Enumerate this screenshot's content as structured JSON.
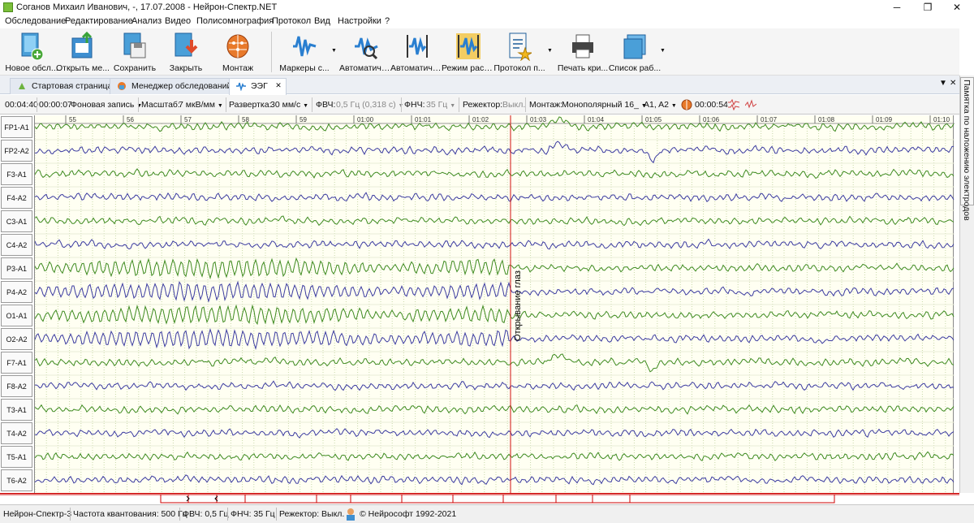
{
  "window": {
    "title": "Соганов Михаил Иванович, -, 17.07.2008 - Нейрон-Спектр.NET",
    "minimize": "─",
    "maximize": "❐",
    "close": "✕"
  },
  "menu": [
    "Обследование",
    "Редактирование",
    "Анализ",
    "Видео",
    "Полисомнография",
    "Протокол",
    "Вид",
    "Настройки",
    "?"
  ],
  "toolbar": {
    "new_exam": "Новое обсл...",
    "open": "Открыть ме...",
    "save": "Сохранить",
    "close": "Закрыть",
    "montage": "Монтаж",
    "markers": "Маркеры с...",
    "auto1": "Автоматиче...",
    "auto2": "Автоматиче...",
    "review_mode": "Режим расс...",
    "protocol": "Протокол п...",
    "print": "Печать кри...",
    "work_list": "Список раб...",
    "dropdown_arrow": "▼"
  },
  "tabs": {
    "start": "Стартовая страница",
    "manager": "Менеджер обследований",
    "eeg": "ЭЭГ",
    "close_mark": "✕",
    "pin_menu": "▼",
    "close_all": "✕"
  },
  "settings": {
    "time_pos": "00:04:40",
    "duration": "00:00:07",
    "record_type": "Фоновая запись",
    "scale_label": "Масштаб:",
    "scale_value": "7 мкВ/мм",
    "sweep_label": "Развертка:",
    "sweep_value": "30 мм/с",
    "hpf_label": "ФВЧ:",
    "hpf_value": "0,5 Гц (0,318 с)",
    "lpf_label": "ФНЧ:",
    "lpf_value": "35 Гц",
    "notch_label": "Режектор:",
    "notch_value": "Выкл.",
    "montage_label": "Монтаж:",
    "montage_value": "Монополярный 16_",
    "ref_value": "A1, A2",
    "elapsed": "00:00:54",
    "arrow": "▼"
  },
  "side_panel": {
    "label": "Памятка по наложению электродов"
  },
  "channels": [
    "FP1-A1",
    "FP2-A2",
    "F3-A1",
    "F4-A2",
    "C3-A1",
    "C4-A2",
    "P3-A1",
    "P4-A2",
    "O1-A1",
    "O2-A2",
    "F7-A1",
    "F8-A2",
    "T3-A1",
    "T4-A2",
    "T5-A1",
    "T6-A2"
  ],
  "timeline": {
    "ticks": [
      "55",
      "56",
      "57",
      "58",
      "59",
      "01:00",
      "01:01",
      "01:02",
      "01:03",
      "01:04",
      "01:05",
      "01:06",
      "01:07",
      "01:08",
      "01:09",
      "01:10"
    ]
  },
  "event_marker": {
    "label": "Открывание глаз"
  },
  "status": {
    "device": "Нейрон-Спектр-3",
    "sampling": "Частота квантования:  500 Гц",
    "hpf": "ФВЧ:  0,5 Гц",
    "lpf": "ФНЧ:  35 Гц",
    "notch": "Режектор:  Выкл.",
    "copyright": "© Нейрософт 1992-2021"
  },
  "colors": {
    "odd_trace": "#3d8a1f",
    "even_trace": "#3b3ba0",
    "marker": "#d01010",
    "background": "#fffff2"
  }
}
